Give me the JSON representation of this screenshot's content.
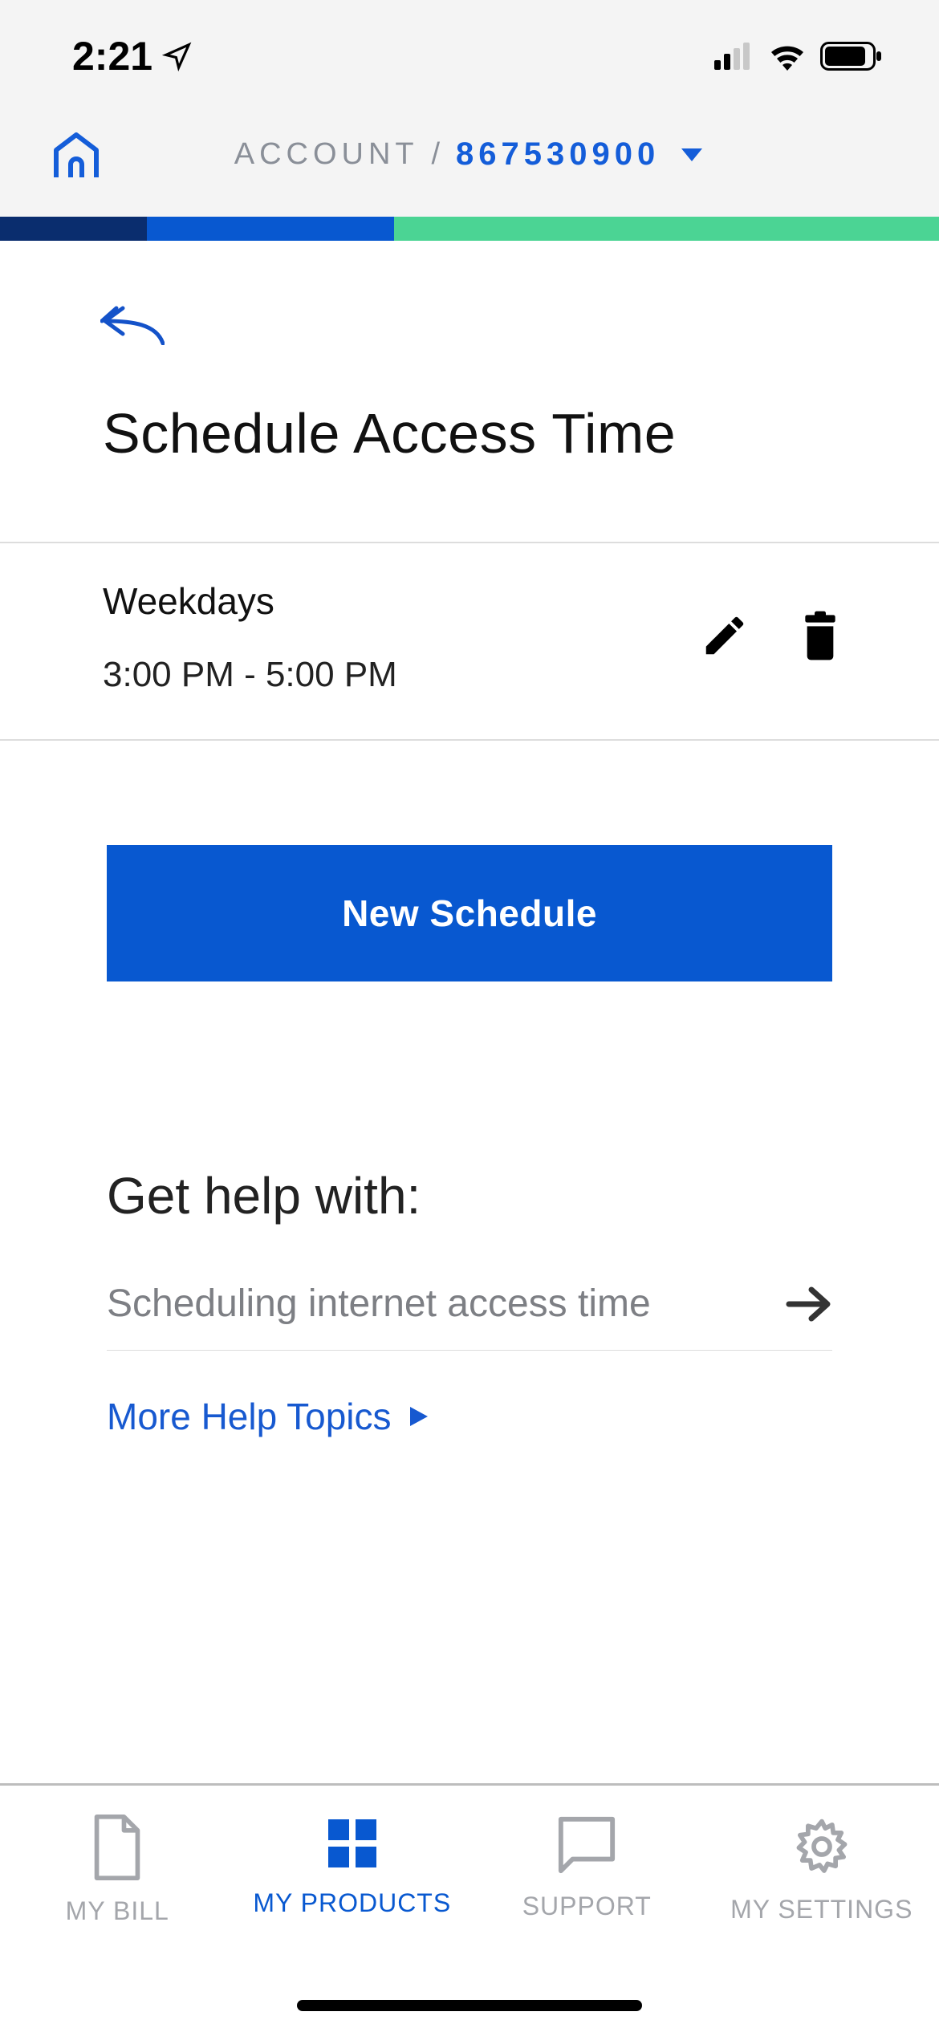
{
  "status": {
    "time": "2:21"
  },
  "header": {
    "account_label": "ACCOUNT /",
    "account_number": "867530900"
  },
  "page": {
    "title": "Schedule Access Time"
  },
  "schedule": {
    "name": "Weekdays",
    "time_range": "3:00 PM - 5:00 PM"
  },
  "buttons": {
    "new_schedule": "New Schedule"
  },
  "help": {
    "title": "Get help with:",
    "item_1": "Scheduling internet access time",
    "more": "More Help Topics"
  },
  "nav": {
    "bill": "MY BILL",
    "products": "MY PRODUCTS",
    "support": "SUPPORT",
    "settings": "MY SETTINGS"
  }
}
